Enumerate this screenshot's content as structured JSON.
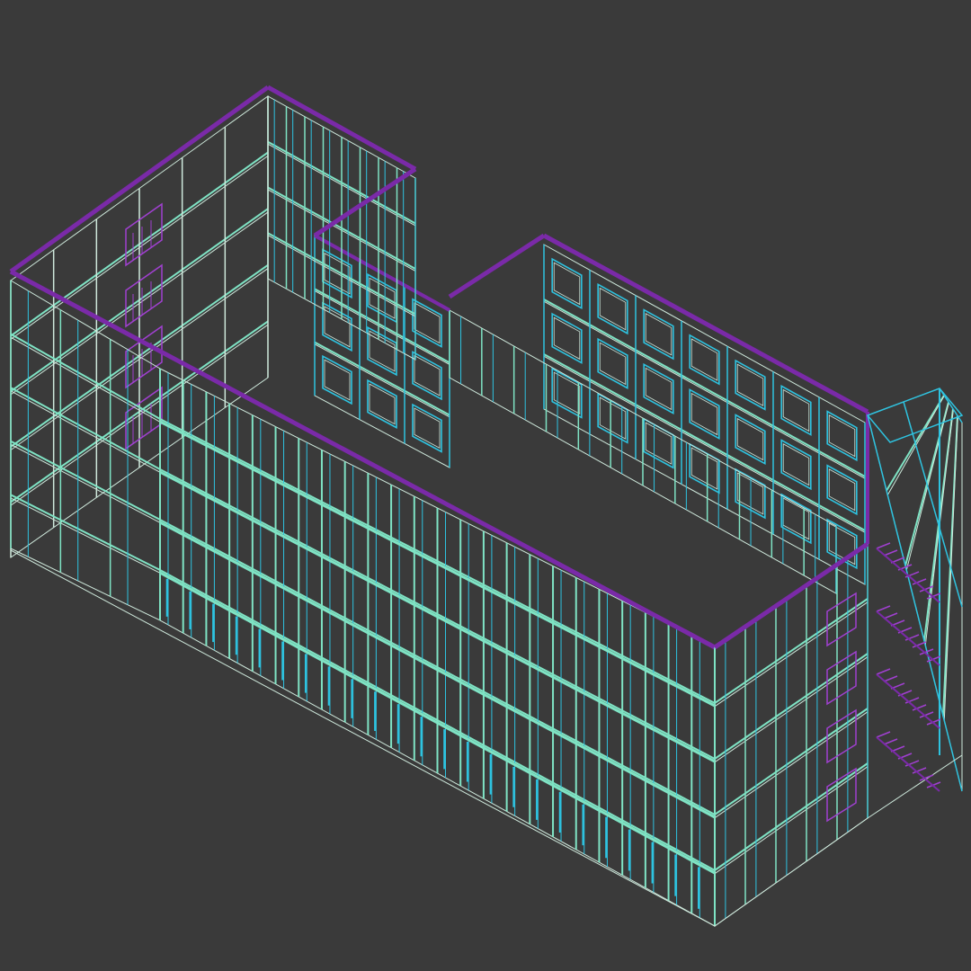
{
  "viewport": {
    "background": "#3a3a3a",
    "line_colors": {
      "roof_edge": "#7a2aa8",
      "facade": "#7fe3c4",
      "window": "#2ec3e0",
      "frame": "#cfe9dc",
      "accent": "#a040d0"
    }
  }
}
